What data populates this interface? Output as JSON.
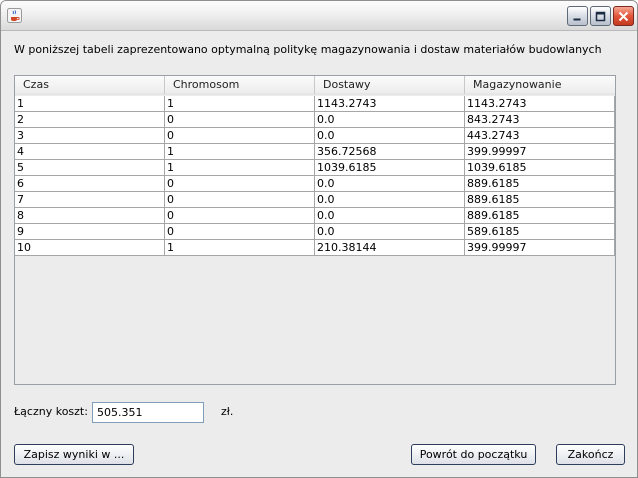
{
  "window": {
    "app_icon": "java-coffee-cup-icon",
    "controls": [
      "minimize-icon",
      "maximize-icon",
      "close-icon"
    ]
  },
  "heading": "W poniższej tabeli zaprezentowano optymalną politykę magazynowania i dostaw materiałów budowlanych",
  "table": {
    "columns": [
      "Czas",
      "Chromosom",
      "Dostawy",
      "Magazynowanie"
    ],
    "rows": [
      [
        "1",
        "1",
        "1143.2743",
        "1143.2743"
      ],
      [
        "2",
        "0",
        "0.0",
        "843.2743"
      ],
      [
        "3",
        "0",
        "0.0",
        "443.2743"
      ],
      [
        "4",
        "1",
        "356.72568",
        "399.99997"
      ],
      [
        "5",
        "1",
        "1039.6185",
        "1039.6185"
      ],
      [
        "6",
        "0",
        "0.0",
        "889.6185"
      ],
      [
        "7",
        "0",
        "0.0",
        "889.6185"
      ],
      [
        "8",
        "0",
        "0.0",
        "889.6185"
      ],
      [
        "9",
        "0",
        "0.0",
        "589.6185"
      ],
      [
        "10",
        "1",
        "210.38144",
        "399.99997"
      ]
    ]
  },
  "cost": {
    "label": "Łączny koszt:",
    "value": "505.351",
    "currency": "zł."
  },
  "buttons": {
    "save": "Zapisz wyniki w ...",
    "reset": "Powrót do początku",
    "exit": "Zakończ"
  },
  "colors": {
    "close_button": "#e2563b",
    "window_bg": "#ececec"
  }
}
